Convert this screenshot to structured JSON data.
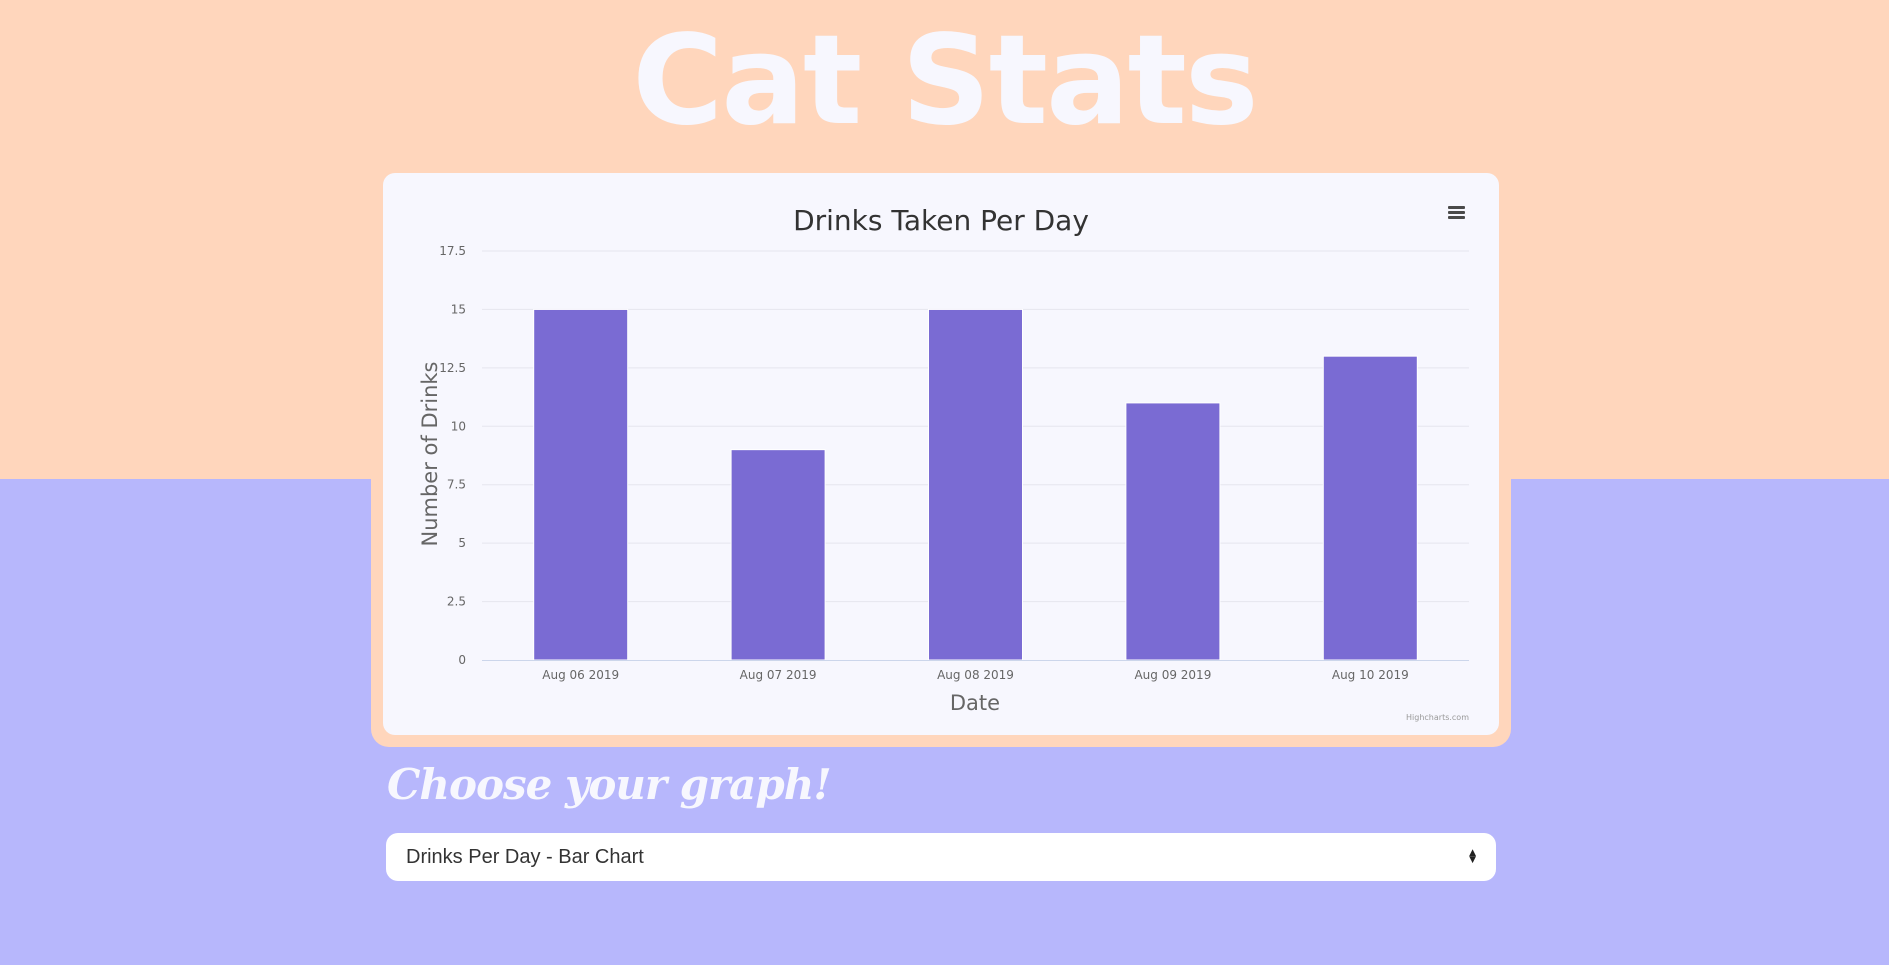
{
  "page": {
    "title": "Cat Stats",
    "heading": "Choose your graph!"
  },
  "select": {
    "value": "Drinks Per Day - Bar Chart"
  },
  "chart_data": {
    "type": "bar",
    "title": "Drinks Taken Per Day",
    "xlabel": "Date",
    "ylabel": "Number of Drinks",
    "categories": [
      "Aug 06 2019",
      "Aug 07 2019",
      "Aug 08 2019",
      "Aug 09 2019",
      "Aug 10 2019"
    ],
    "values": [
      15,
      9,
      15,
      11,
      13
    ],
    "ylim": [
      0,
      17.5
    ],
    "yticks": [
      "0",
      "2.5",
      "5",
      "7.5",
      "10",
      "12.5",
      "15",
      "17.5"
    ],
    "grid": true,
    "credit": "Highcharts.com",
    "colors": {
      "bar": "#7a6bd3",
      "grid": "#e6e6ee",
      "axis": "#ccd6eb",
      "text": "#333333",
      "tick_text": "#666666"
    }
  },
  "colors": {
    "top_background": "#ffd6bc",
    "bottom_background": "#b7b7fc",
    "card": "#f7f7fe",
    "title_text": "#f7f7fe"
  },
  "icons": {
    "menu": "hamburger-menu-icon",
    "select_arrows": "sort-arrows-icon"
  }
}
